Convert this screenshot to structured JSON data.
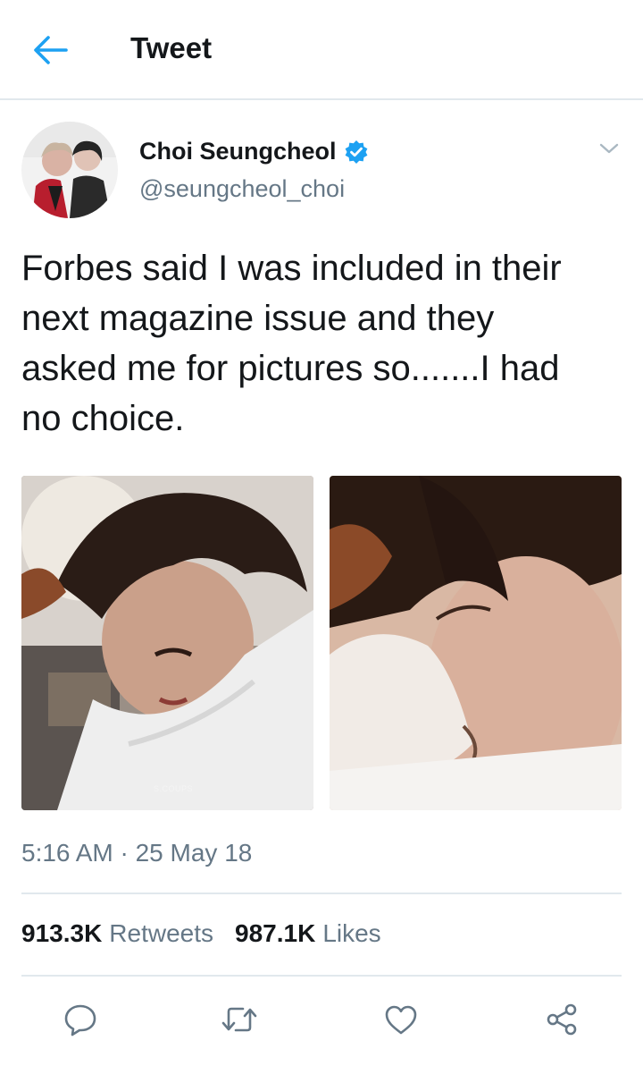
{
  "header": {
    "title": "Tweet",
    "back_icon": "arrow-left-icon"
  },
  "author": {
    "display_name": "Choi Seungcheol",
    "handle": "@seungcheol_choi",
    "verified": true,
    "verified_icon": "verified-badge-icon",
    "menu_icon": "chevron-down-icon"
  },
  "tweet": {
    "text": "Forbes said I was included in their\nnext magazine issue and they\nasked me for pictures so.......I had\nno choice.",
    "media_watermark": "S.COUPS",
    "timestamp": "5:16 AM · 25 May 18"
  },
  "stats": {
    "retweets_count": "913.3K",
    "retweets_label": "Retweets",
    "likes_count": "987.1K",
    "likes_label": "Likes"
  },
  "actions": [
    {
      "icon": "reply-icon"
    },
    {
      "icon": "retweet-icon"
    },
    {
      "icon": "like-heart-icon"
    },
    {
      "icon": "share-icon"
    }
  ],
  "colors": {
    "accent": "#1da1f2",
    "text_primary": "#14171a",
    "text_secondary": "#657786",
    "divider": "#e1e8ed"
  }
}
